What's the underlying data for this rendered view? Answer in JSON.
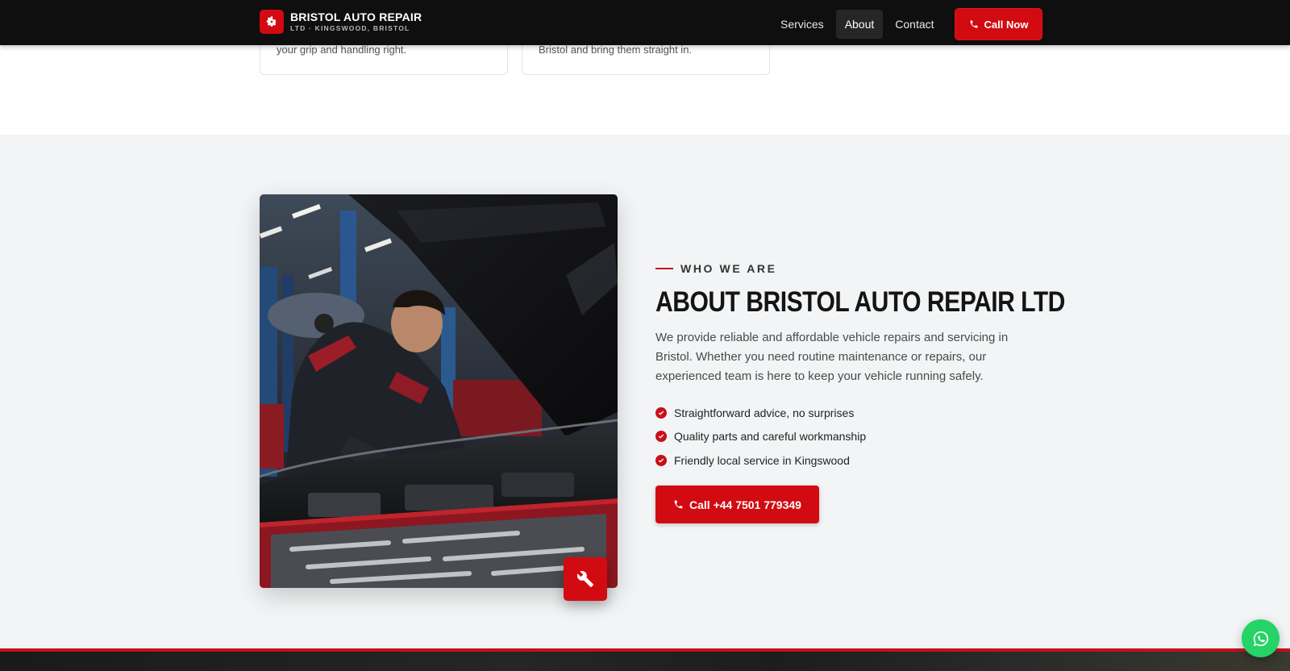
{
  "header": {
    "brand_name": "BRISTOL AUTO REPAIR",
    "brand_sub": "LTD · KINGSWOOD, BRISTOL",
    "nav": [
      {
        "label": "Services"
      },
      {
        "label": "About",
        "active": true
      },
      {
        "label": "Contact"
      }
    ],
    "call_now_label": "Call Now"
  },
  "cards": [
    {
      "text": "your grip and handling right."
    },
    {
      "text": "Bristol and bring them straight in."
    }
  ],
  "about": {
    "eyebrow": "WHO WE ARE",
    "heading": "ABOUT BRISTOL AUTO REPAIR LTD",
    "description": "We provide reliable and affordable vehicle repairs and servicing in Bristol. Whether you need routine maintenance or repairs, our experienced team is here to keep your vehicle running safely.",
    "features": [
      "Straightforward advice, no surprises",
      "Quality parts and careful workmanship",
      "Friendly local service in Kingswood"
    ],
    "cta_label": "Call +44 7501 779349",
    "photo_icon": "mechanic-photo",
    "badge_icon": "wrench-icon"
  },
  "floating": {
    "whatsapp_icon": "whatsapp-icon"
  },
  "colors": {
    "accent": "#d20a11",
    "header_bg": "#0f0f0f",
    "section_bg": "#f2f4f5",
    "whatsapp": "#25d366"
  }
}
